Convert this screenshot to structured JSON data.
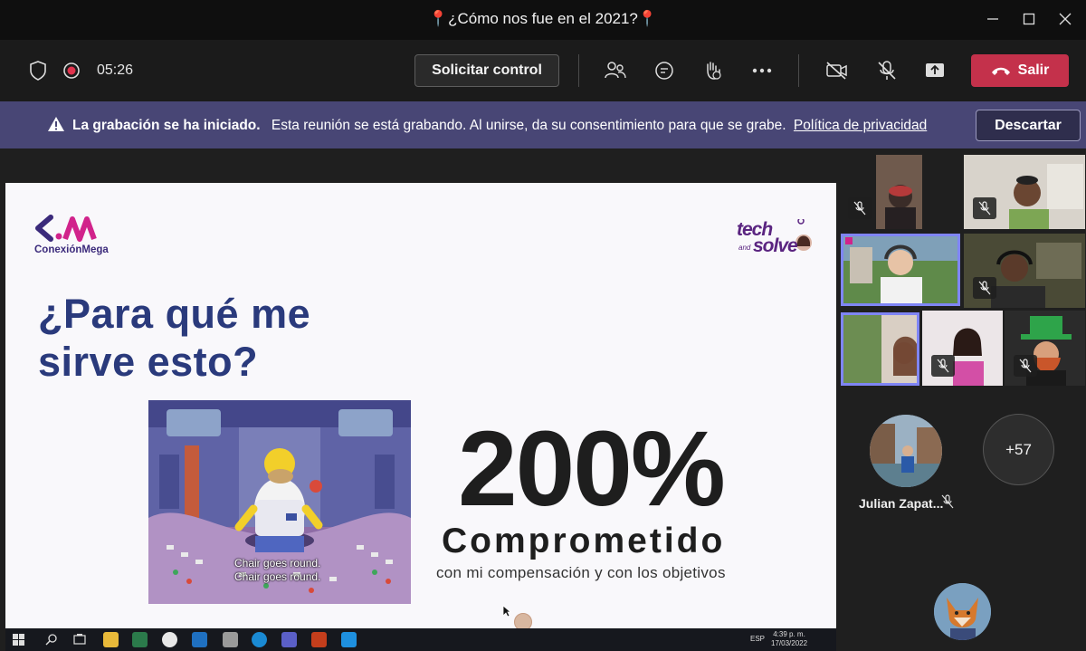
{
  "window": {
    "title": "📍¿Cómo nos fue en el 2021?📍"
  },
  "toolbar": {
    "timer": "05:26",
    "control_label": "Solicitar control",
    "leave_label": "Salir",
    "leave_color": "#c4314b"
  },
  "banner": {
    "title": "La grabación se ha iniciado.",
    "message": "Esta reunión se está grabando. Al unirse, da su consentimiento para que se grabe.",
    "link": "Política de privacidad",
    "dismiss_label": "Descartar",
    "background": "#484675"
  },
  "slide": {
    "brand_left": "ConexiónMega",
    "brand_right": "tech and solve",
    "headline": "¿Para qué me sirve esto?",
    "gif_caption_1": "Chair goes round.",
    "gif_caption_2": "Chair goes round.",
    "big_number": "200%",
    "big_word": "Comprometido",
    "subtitle": "con mi compensación y con los objetivos"
  },
  "taskbar": {
    "language": "ESP",
    "time": "4:39 p. m.",
    "date": "17/03/2022"
  },
  "participants": {
    "featured_name": "Julian Zapat...",
    "overflow_count": "+57"
  }
}
